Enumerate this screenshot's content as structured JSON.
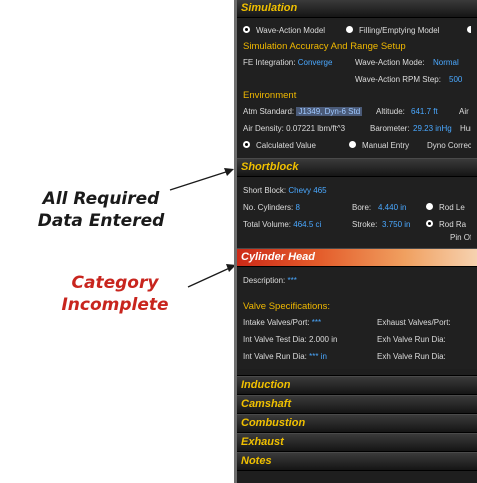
{
  "annotations": {
    "callout_1": [
      "All Required",
      "Data Entered"
    ],
    "callout_2": [
      "Category",
      "Incomplete"
    ]
  },
  "simulation": {
    "title": "Simulation",
    "options": [
      "Wave-Action Model",
      "Filling/Emptying Model"
    ],
    "accuracy_title": "Simulation Accuracy And Range Setup",
    "fe_integration_label": "FE Integration:",
    "fe_integration_value": "Converge",
    "wave_mode_label": "Wave-Action Mode:",
    "wave_mode_value": "Normal",
    "rpm_step_label": "Wave-Action RPM Step:",
    "rpm_step_value": "500",
    "environment_title": "Environment",
    "atm_label": "Atm Standard:",
    "atm_value": "J1349, Dyn-6 Std",
    "altitude_label": "Altitude:",
    "altitude_value": "641.7 ft",
    "air_t_label": "Air T",
    "air_density_label": "Air Density:",
    "air_density_value": "0.07221 lbm/ft^3",
    "barometer_label": "Barometer:",
    "barometer_value": "29.23 inHg",
    "humidity_label": "Hum",
    "calc_label": "Calculated Value",
    "manual_label": "Manual Entry",
    "dyno_label": "Dyno Correctio"
  },
  "shortblock": {
    "title": "Shortblock",
    "short_block_label": "Short Block:",
    "short_block_value": "Chevy 465",
    "cyl_label": "No. Cylinders:",
    "cyl_value": "8",
    "bore_label": "Bore:",
    "bore_value": "4.440 in",
    "rod_le": "Rod Le",
    "total_vol_label": "Total Volume:",
    "total_vol_value": "464.5 ci",
    "stroke_label": "Stroke:",
    "stroke_value": "3.750 in",
    "rod_ra": "Rod Ra",
    "pin_offs": "Pin Offs"
  },
  "cylinder_head": {
    "title": "Cylinder Head",
    "description_label": "Description:",
    "description_value": "***",
    "valve_title": "Valve Specifications:",
    "intake_label": "Intake Valves/Port:",
    "intake_value": "***",
    "exhaust_label": "Exhaust Valves/Port:",
    "int_test_label": "Int Valve Test Dia:",
    "int_test_value": "2.000 in",
    "exh_run_label_1": "Exh Valve Run Dia:",
    "int_run_label": "Int Valve Run Dia:",
    "int_run_value": "*** in",
    "exh_run_label_2": "Exh Valve Run Dia:"
  },
  "collapsed_sections": [
    "Induction",
    "Camshaft",
    "Combustion",
    "Exhaust",
    "Notes"
  ]
}
